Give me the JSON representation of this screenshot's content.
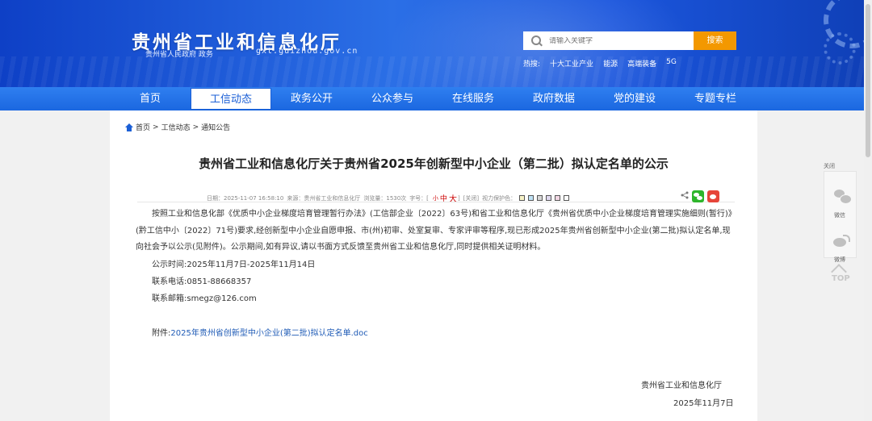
{
  "header": {
    "site_title": "贵州省工业和信息化厅",
    "site_subtitle": "贵州省人民政府 政务",
    "site_domain": "gxt.guizhou.gov.cn",
    "search_placeholder": "请输入关键字",
    "search_button": "搜索",
    "hot_label": "热搜:",
    "hot_items": [
      "十大工业产业",
      "能源",
      "高端装备",
      "5G"
    ]
  },
  "nav": {
    "items": [
      "首页",
      "工信动态",
      "政务公开",
      "公众参与",
      "在线服务",
      "政府数据",
      "党的建设",
      "专题专栏"
    ],
    "active": "工信动态"
  },
  "breadcrumb": {
    "home": "首页",
    "sep": ">",
    "level1": "工信动态",
    "level2": "通知公告"
  },
  "article": {
    "title": "贵州省工业和信息化厅关于贵州省2025年创新型中小企业（第二批）拟认定名单的公示",
    "date_label": "日期：2025-11-07 16:58:10",
    "source_label": "来源：贵州省工业和信息化厅",
    "views_label": "浏览量：1530次",
    "font_label": "字号：[",
    "font_small": "小",
    "font_mid": "中",
    "font_big": "大",
    "font_end": "]",
    "close_label": "[关闭]",
    "vision_label": "视力保护色：",
    "vision_colors": [
      "#f8f4c8",
      "#bfe2f5",
      "#d7d7d7",
      "#e0d9ef",
      "#f2d7e4",
      "#ffffff"
    ],
    "paragraph": "按照工业和信息化部《优质中小企业梯度培育管理暂行办法》(工信部企业〔2022〕63号)和省工业和信息化厅《贵州省优质中小企业梯度培育管理实施细则(暂行)》(黔工信中小〔2022〕71号)要求,经创新型中小企业自愿申报、市(州)初审、处室复审、专家评审等程序,现已形成2025年贵州省创新型中小企业(第二批)拟认定名单,现向社会予以公示(见附件)。公示期间,如有异议,请以书面方式反馈至贵州省工业和信息化厅,同时提供相关证明材料。",
    "notice_period": "公示时间:2025年11月7日-2025年11月14日",
    "contact_phone": "联系电话:0851-88668357",
    "contact_email": "联系邮箱:smegz@126.com",
    "attachment_label": "附件:",
    "attachment_link": "2025年贵州省创新型中小企业(第二批)拟认定名单.doc",
    "signature_org": "贵州省工业和信息化厅",
    "signature_date": "2025年11月7日"
  },
  "float_panel": {
    "close": "关闭",
    "wechat": "微信",
    "weibo": "微博",
    "top": "TOP"
  }
}
